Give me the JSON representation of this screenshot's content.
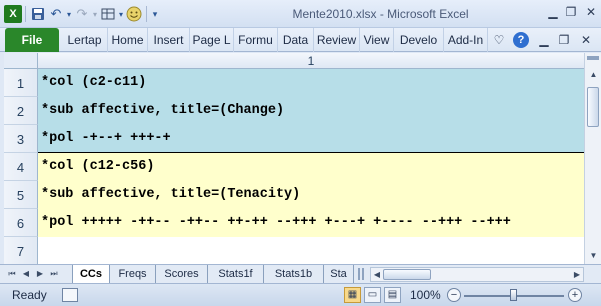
{
  "window": {
    "title": "Mente2010.xlsx - Microsoft Excel",
    "app_icon": "excel-icon"
  },
  "qat": {
    "icons": [
      "save-icon",
      "undo-icon",
      "redo-icon",
      "form-icon",
      "smiley-icon",
      "customize-icon"
    ]
  },
  "ribbon": {
    "file_label": "File",
    "tabs": [
      "Lertap",
      "Home",
      "Insert",
      "Page L",
      "Formu",
      "Data",
      "Review",
      "View",
      "Develo",
      "Add-In"
    ],
    "file_color": "#2a872a"
  },
  "sheet": {
    "column_header": "1",
    "rows": [
      {
        "num": "1",
        "text": "*col (c2-c11)"
      },
      {
        "num": "2",
        "text": "*sub affective, title=(Change)"
      },
      {
        "num": "3",
        "text": "*pol -+--+ +++-+"
      },
      {
        "num": "4",
        "text": "*col (c12-c56)"
      },
      {
        "num": "5",
        "text": "*sub affective, title=(Tenacity)"
      },
      {
        "num": "6",
        "text": "*pol +++++ -++-- -++-- ++-++ --+++ +---+ +---- --+++ --+++"
      },
      {
        "num": "7",
        "text": ""
      }
    ],
    "colors": {
      "group1": "#b7dee8",
      "group2": "#ffffcc"
    }
  },
  "sheet_tabs": [
    "CCs",
    "Freqs",
    "Scores",
    "Stats1f",
    "Stats1b",
    "Sta"
  ],
  "active_tab": "CCs",
  "status": {
    "ready": "Ready",
    "zoom": "100%",
    "zoom_fraction": 0.5
  }
}
